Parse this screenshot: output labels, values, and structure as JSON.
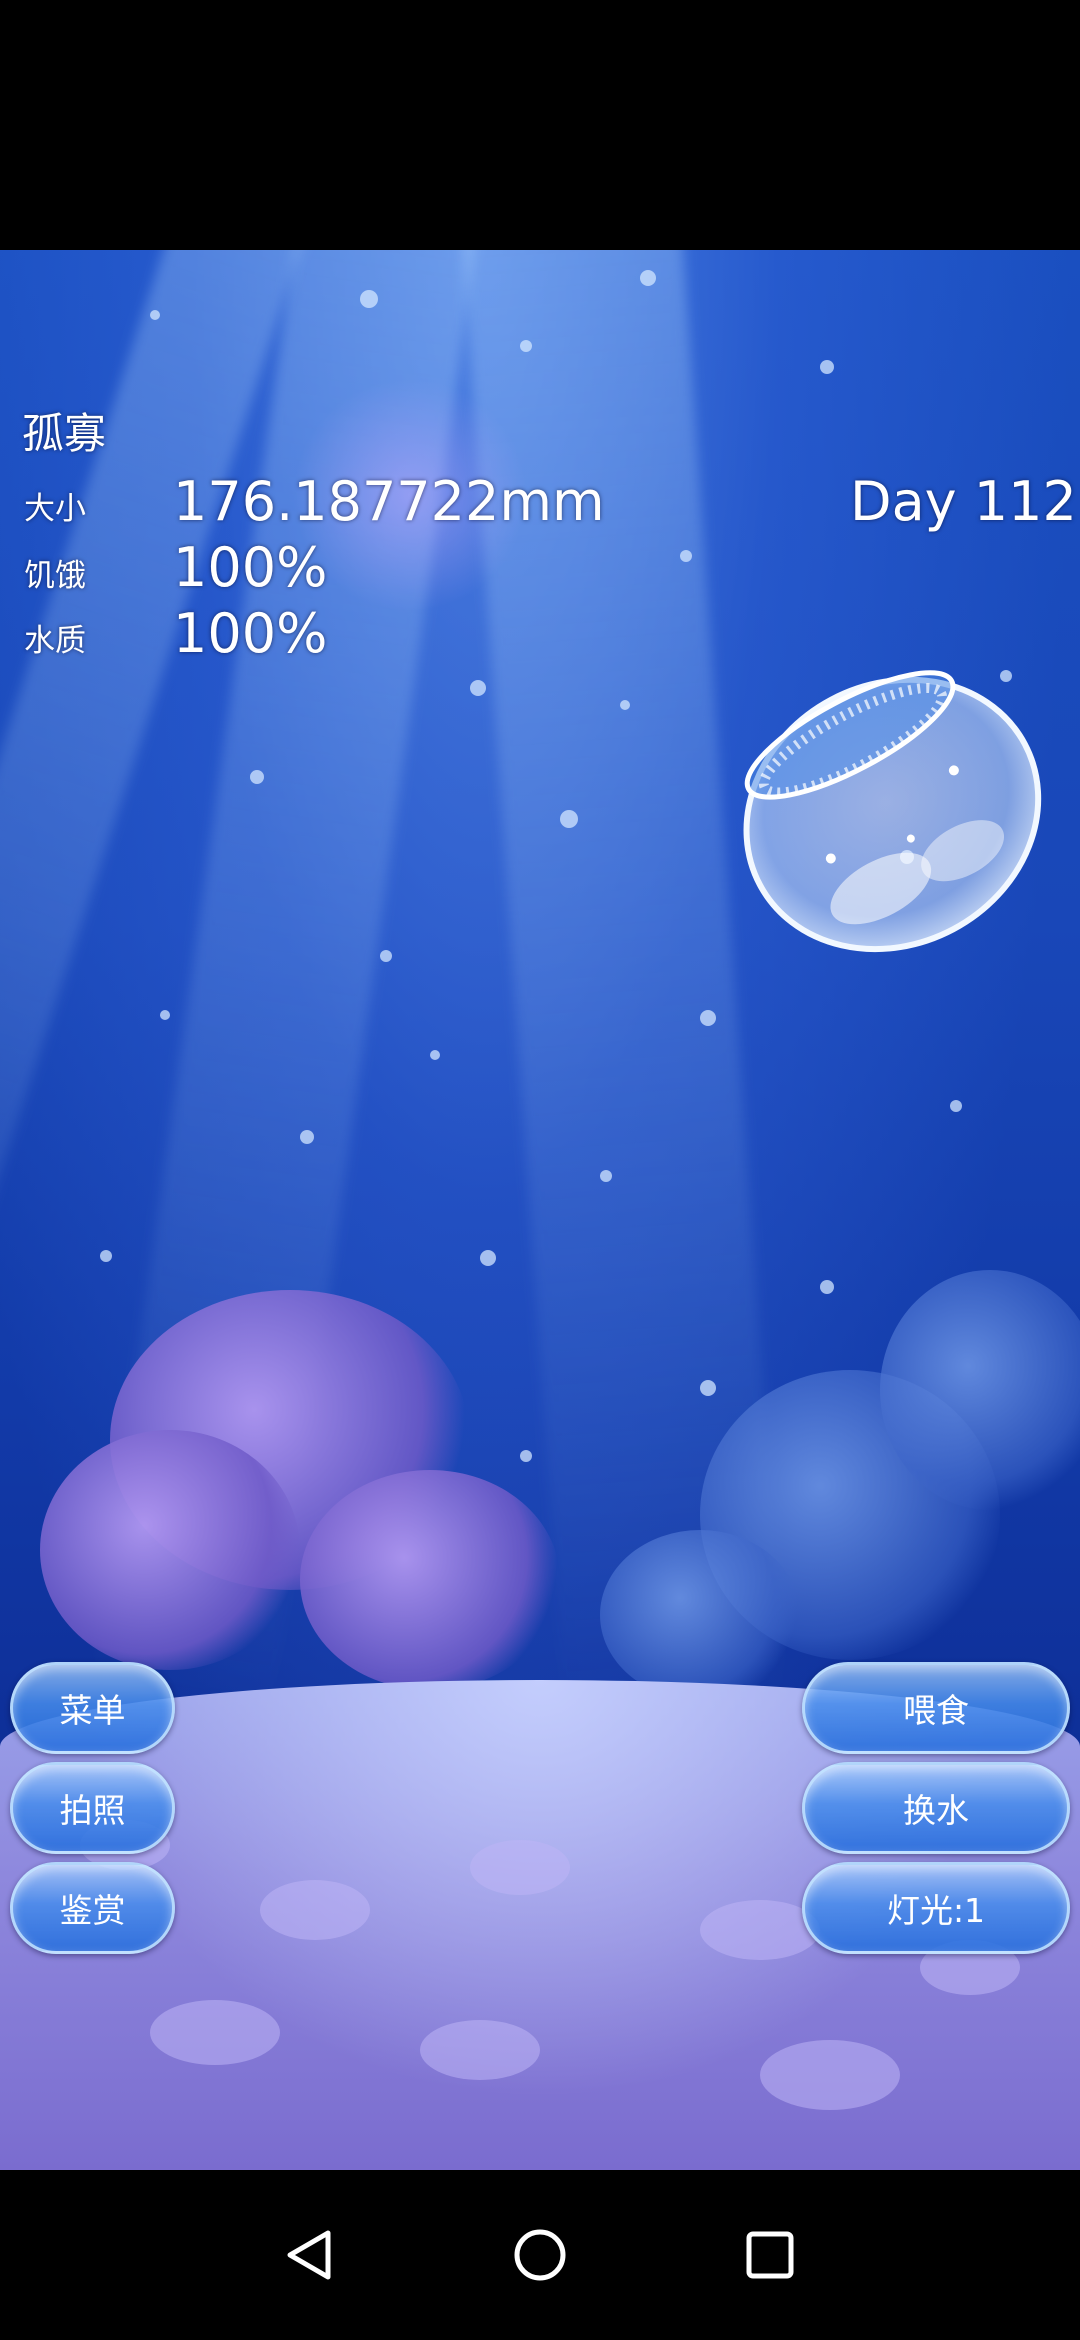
{
  "status": {
    "mood": "孤寡",
    "size_label": "大小",
    "size_value": "176.187722mm",
    "hunger_label": "饥饿",
    "hunger_value": "100%",
    "water_label": "水质",
    "water_value": "100%",
    "day": "Day 112"
  },
  "buttons_left": [
    {
      "label": "菜单"
    },
    {
      "label": "拍照"
    },
    {
      "label": "鉴赏"
    }
  ],
  "buttons_right": [
    {
      "label": "喂食"
    },
    {
      "label": "换水"
    },
    {
      "label": "灯光:1"
    }
  ],
  "nav": {
    "icons": [
      "back-triangle-icon",
      "home-circle-icon",
      "recents-square-icon"
    ]
  },
  "colors": {
    "water_top": "#1a4fc0",
    "water_bottom": "#0b2a8a",
    "button_fill": "#3c8ce6",
    "button_border": "#c8e6ff",
    "sand": "#8e88dd"
  }
}
